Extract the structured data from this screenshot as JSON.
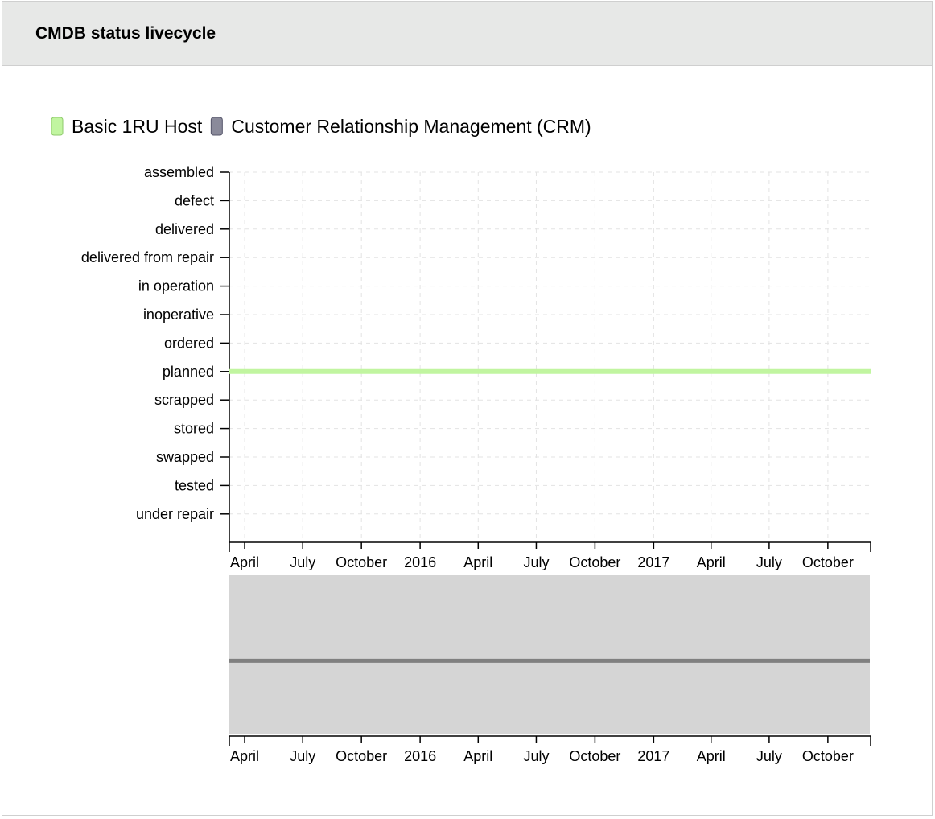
{
  "panel": {
    "title": "CMDB status livecycle"
  },
  "colors": {
    "series_basic": "#c1f5a0",
    "series_basic_border": "#8ec96b",
    "series_crm": "#8a8a9a",
    "series_crm_border": "#55556a",
    "grid": "#e3e3e3",
    "brush_background": "#d5d5d5",
    "brush_line": "#808080"
  },
  "chart_data": {
    "type": "line",
    "title": "",
    "xlabel": "",
    "ylabel": "",
    "legend": "top-left",
    "grid": true,
    "y_type": "categorical",
    "y_categories": [
      "assembled",
      "defect",
      "delivered",
      "delivered from repair",
      "in operation",
      "inoperative",
      "ordered",
      "planned",
      "scrapped",
      "stored",
      "swapped",
      "tested",
      "under repair"
    ],
    "x_type": "time",
    "xlim": [
      "2015-03-08",
      "2017-12-07"
    ],
    "x_ticks": [
      {
        "date": "2015-04-01",
        "label": "April"
      },
      {
        "date": "2015-07-01",
        "label": "July"
      },
      {
        "date": "2015-10-01",
        "label": "October"
      },
      {
        "date": "2016-01-01",
        "label": "2016"
      },
      {
        "date": "2016-04-01",
        "label": "April"
      },
      {
        "date": "2016-07-01",
        "label": "July"
      },
      {
        "date": "2016-10-01",
        "label": "October"
      },
      {
        "date": "2017-01-01",
        "label": "2017"
      },
      {
        "date": "2017-04-01",
        "label": "April"
      },
      {
        "date": "2017-07-01",
        "label": "July"
      },
      {
        "date": "2017-10-01",
        "label": "October"
      }
    ],
    "series": [
      {
        "name": "Basic 1RU Host",
        "points": [
          {
            "x": "2015-03-08",
            "y": "planned"
          },
          {
            "x": "2017-12-07",
            "y": "planned"
          }
        ]
      },
      {
        "name": "Customer Relationship Management (CRM)",
        "points": []
      }
    ],
    "brush": {
      "xlim": [
        "2015-03-08",
        "2017-12-07"
      ],
      "line_level": 0.54
    }
  }
}
